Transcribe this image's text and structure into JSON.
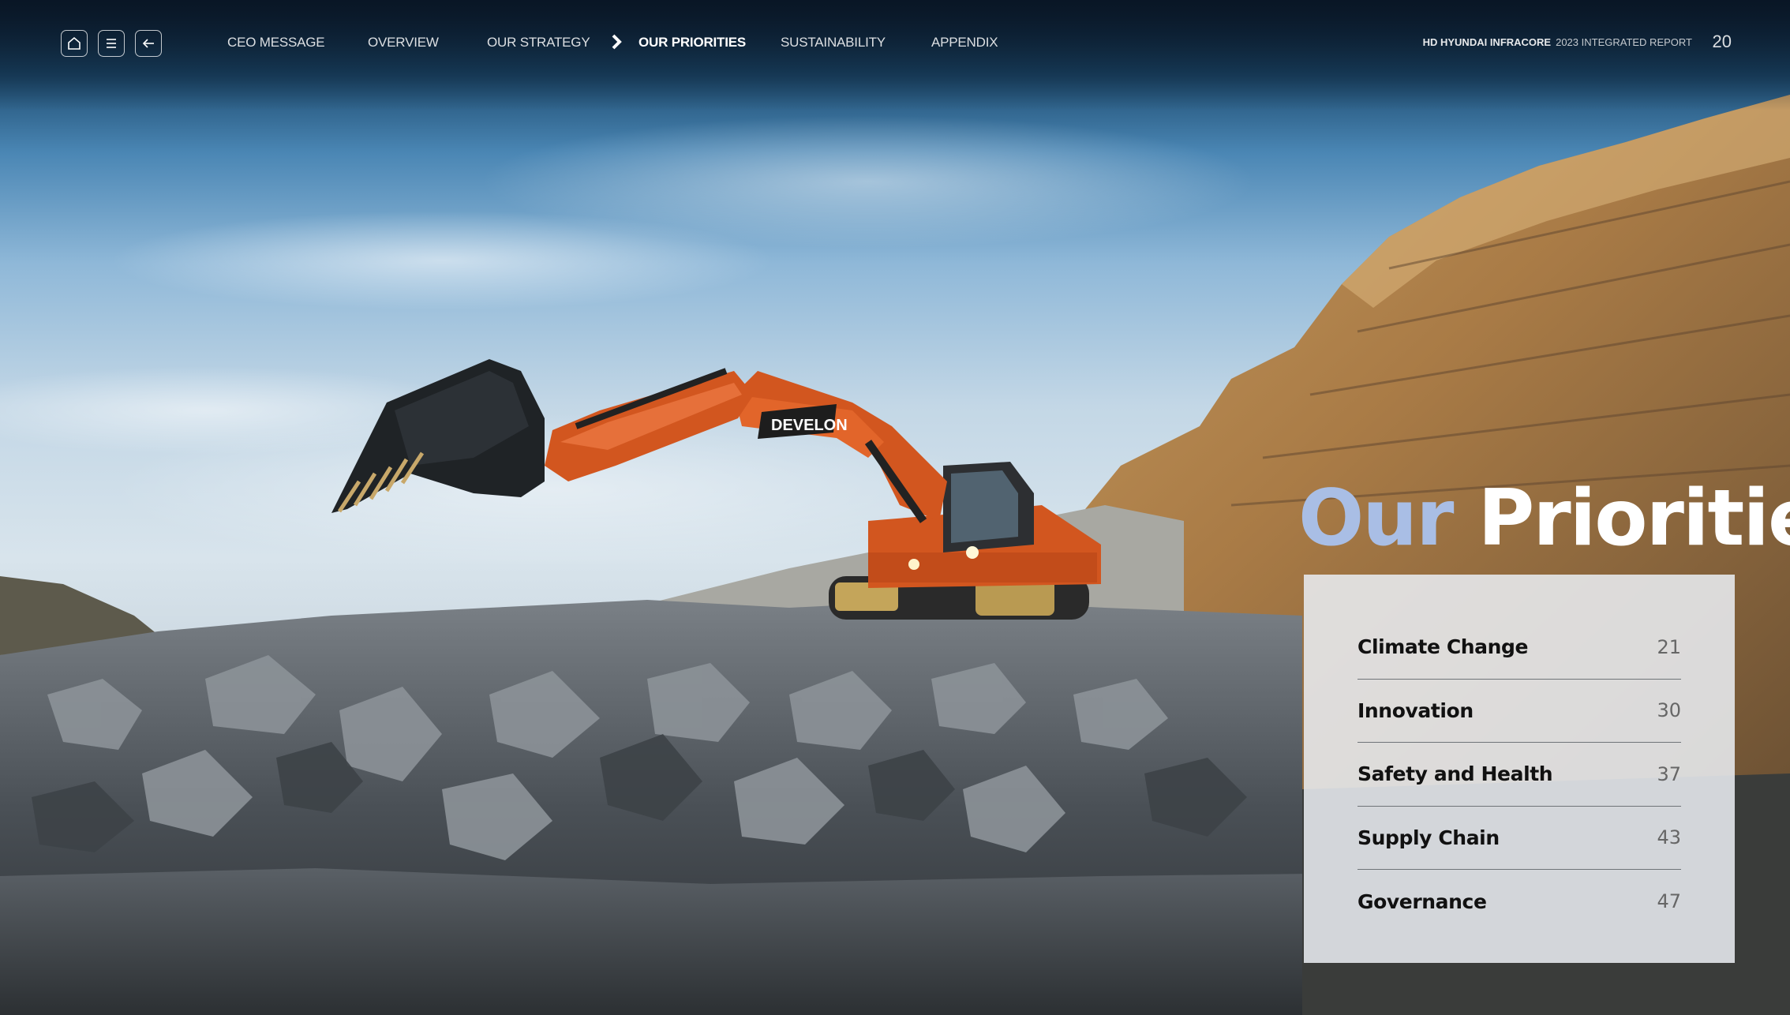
{
  "nav": {
    "icons": {
      "home": "home-icon",
      "menu": "menu-icon",
      "back": "back-arrow-icon"
    },
    "items": [
      {
        "label": "CEO MESSAGE"
      },
      {
        "label": "OVERVIEW"
      },
      {
        "label": "OUR STRATEGY"
      },
      {
        "label": "OUR PRIORITIES",
        "active": true
      },
      {
        "label": "SUSTAINABILITY"
      },
      {
        "label": "APPENDIX"
      }
    ]
  },
  "header": {
    "company": "HD HYUNDAI INFRACORE",
    "report": "2023 INTEGRATED REPORT",
    "page_number": "20"
  },
  "hero": {
    "title_part1": "Our",
    "title_part2": "Priorities",
    "machine_brand": "DEVELON"
  },
  "priorities": [
    {
      "label": "Climate Change",
      "page": "21"
    },
    {
      "label": "Innovation",
      "page": "30"
    },
    {
      "label": "Safety and Health",
      "page": "37"
    },
    {
      "label": "Supply Chain",
      "page": "43"
    },
    {
      "label": "Governance",
      "page": "47"
    }
  ],
  "colors": {
    "title_accent": "#a9bee5",
    "excavator_orange": "#d2561f"
  }
}
